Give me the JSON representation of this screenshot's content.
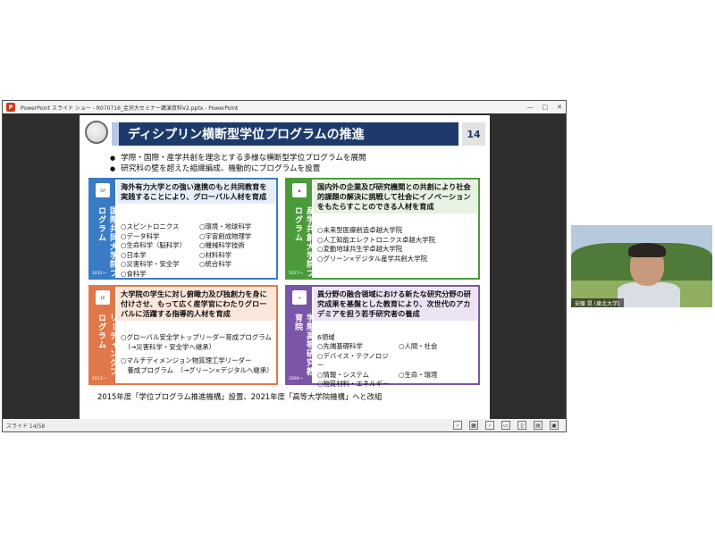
{
  "window": {
    "title": "PowerPoint スライド ショー - R070716_金沢大セミナー講演資料V2.pptx - PowerPoint",
    "app_icon_label": "P",
    "controls": [
      "—",
      "□",
      "✕"
    ]
  },
  "slide": {
    "title": "ディシプリン横断型学位プログラムの推進",
    "number": "14",
    "bullets": [
      "学際・国際・産学共創を理念とする多様な横断型学位プログラムを展開",
      "研究科の壁を超えた組織編成、機動的にプログラムを設置"
    ],
    "boxes": {
      "intl": {
        "side_label": "国際共同大学院プログラム",
        "logo": "GP",
        "year": "2015〜",
        "heading": "海外有力大学との強い連携のもと共同教育を実践することにより、グローバル人材を育成",
        "items": [
          "○スピントロニクス",
          "○環境・地球科学",
          "○データ科学",
          "○宇宙創成物理学",
          "○生命科学（脳科学）",
          "○機械科学技術",
          "○日本学",
          "○材料科学",
          "○災害科学・安全学",
          "○統合科学",
          "○食科学",
          ""
        ]
      },
      "industry": {
        "side_label": "産学共創大学院プログラム",
        "year": "2017〜",
        "heading": "国内外の企業及び研究機関との共創により社会的課題の解決に挑戦して社会にイノベーションをもたらすことのできる人材を育成",
        "items": [
          "○未来型医療創造卓越大学院",
          "○人工知能エレクトロニクス卓越大学院",
          "○変動地球共生学卓越大学院",
          "○グリーン×デジタル産学共創大学院"
        ]
      },
      "leading": {
        "side_label": "リーディングプログラム",
        "logo": "LP",
        "year": "2013〜",
        "heading": "大学院の学生に対し俯瞰力及び独創力を身に付けさせ、もって広く産学官にわたりグローバルに活躍する指導的人材を育成",
        "items": [
          "○グローバル安全学トップリーダー育成プログラム",
          "　（→災害科学・安全学へ継承）",
          "○マルチディメンジョン物質理工学リーダー",
          "　養成プログラム　（→グリーン×デジタルへ継承）"
        ]
      },
      "advanced": {
        "side_label": "学際高等研究教育院",
        "year": "2006〜",
        "heading": "異分野の融合領域における新たな研究分野の研究成果を基盤とした教育により、次世代のアカデミアを担う若手研究者の養成",
        "intro": "6領域",
        "items": [
          "○先端基礎科学",
          "○人間・社会",
          "○デバイス・テクノロジー",
          "",
          "○情報・システム",
          "○生命・環境",
          "○物質材料・エネルギー",
          ""
        ]
      }
    },
    "footer": "2015年度「学位プログラム推進機構」設置、2021年度「高等大学院機構」へと改組"
  },
  "statusbar": {
    "slide_count": "スライド 14/58",
    "buttons": [
      "‹",
      "▦",
      "›",
      "▭",
      "▯",
      "▤",
      "▣"
    ]
  },
  "webcam": {
    "name_tag": "安藤 晃 (東北大学)"
  },
  "colors": {
    "title_bar": "#1d3a6b",
    "intl": "#3a7bc4",
    "industry": "#4b9a3c",
    "leading": "#e0784a",
    "advanced": "#7b55a8"
  }
}
